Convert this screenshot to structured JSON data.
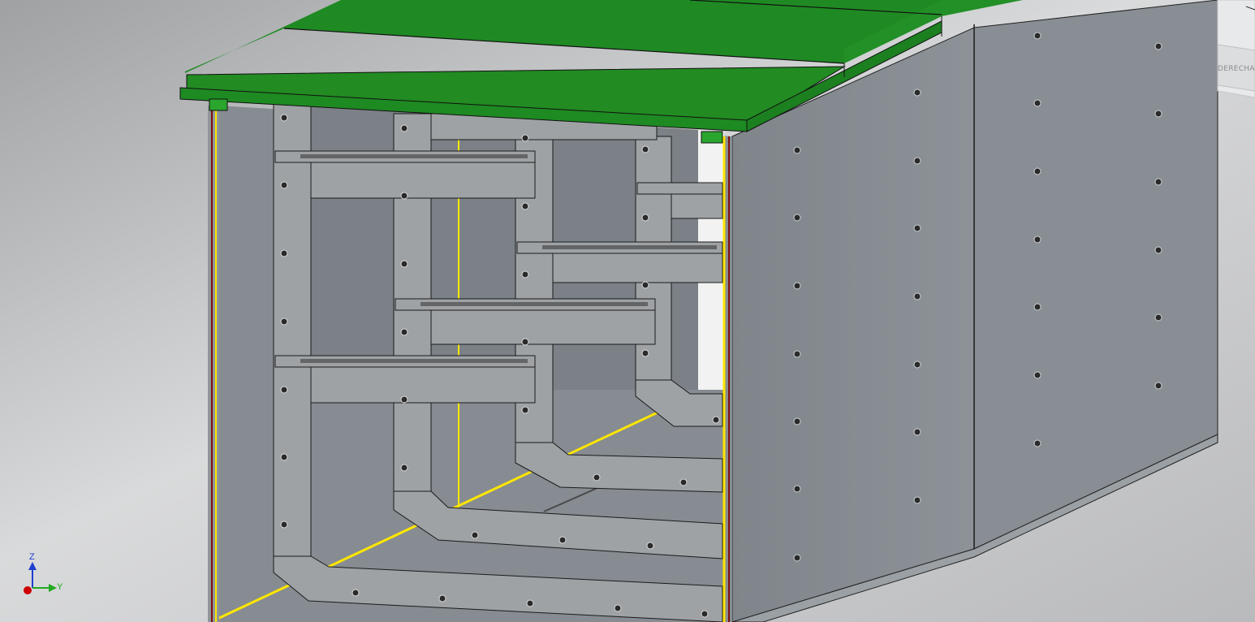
{
  "viewport": {
    "background_color": "#c8c9cb",
    "lid_color": "#228b22",
    "wall_color": "#858b90",
    "frame_color": "#9a9ea1",
    "edge_line_color": "#e8d400"
  },
  "view_cube": {
    "face_label": "DERECHA"
  },
  "triad": {
    "z_label": "Z",
    "y_label": "Y",
    "x_color": "#cc0000",
    "y_color": "#22aa22",
    "z_color": "#1f3fd1"
  }
}
